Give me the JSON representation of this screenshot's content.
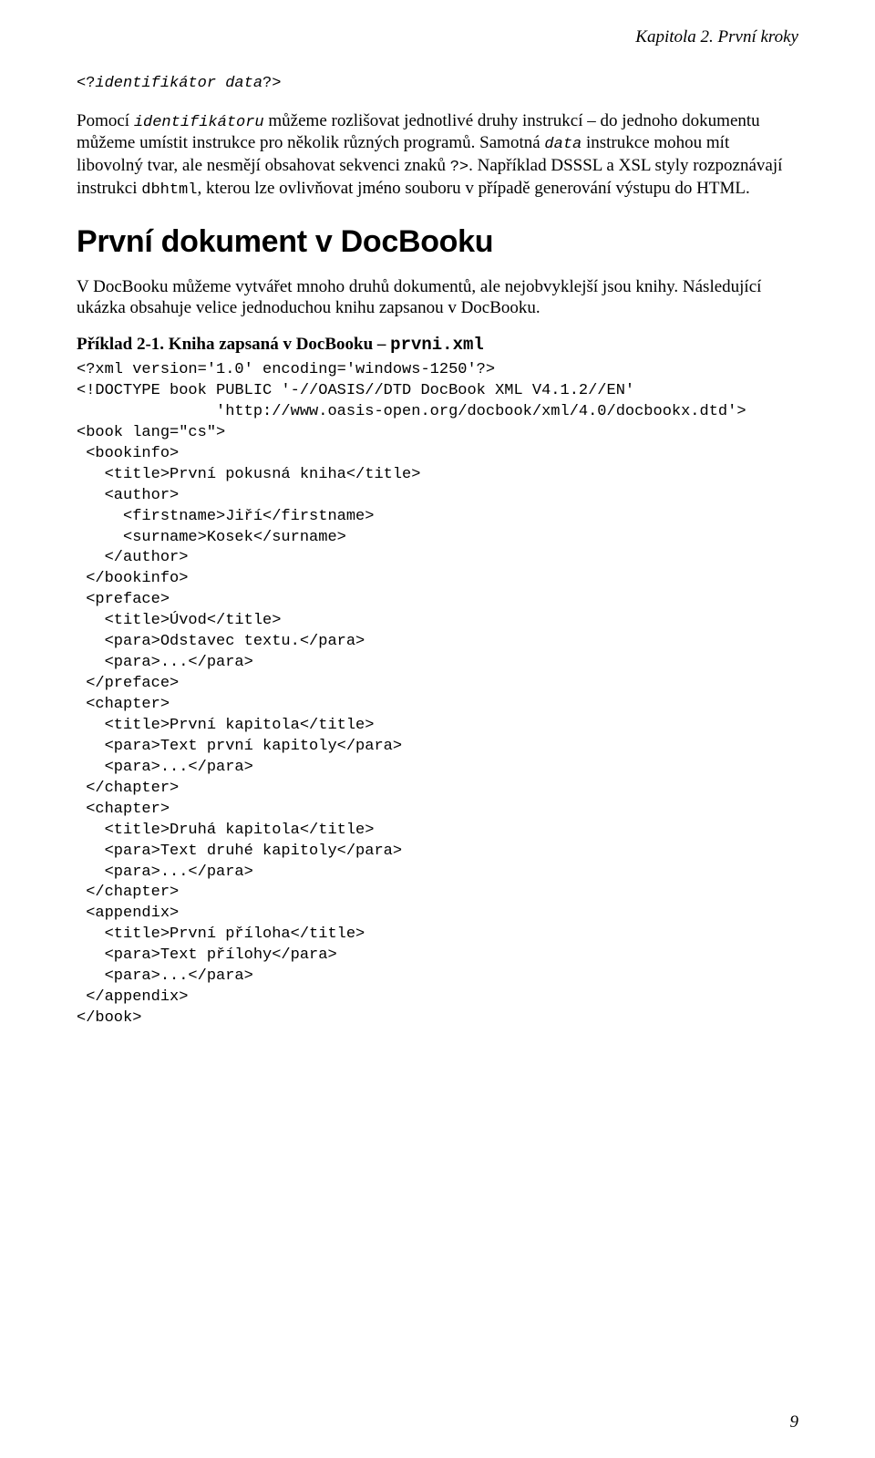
{
  "header": {
    "chapter_label": "Kapitola 2. První kroky"
  },
  "intro": {
    "line1_pre": "<?",
    "line1_ident": "identifikátor data",
    "line1_post": "?>",
    "para1_a": "Pomocí ",
    "para1_b": "identifikátoru",
    "para1_c": " můžeme rozlišovat jednotlivé druhy instrukcí – do jednoho dokumentu můžeme umístit instrukce pro několik různých programů. Samotná ",
    "para1_d": "data",
    "para1_e": " instrukce mohou mít libovolný tvar, ale nesmějí obsahovat sekvenci znaků ",
    "para1_f": "?>",
    "para1_g": ". Například DSSSL a XSL styly rozpoznávají instrukci ",
    "para1_h": "dbhtml",
    "para1_i": ", kterou lze ovlivňovat jméno souboru v případě generování výstupu do HTML."
  },
  "section": {
    "title": "První dokument v DocBooku",
    "para": "V DocBooku můžeme vytvářet mnoho druhů dokumentů, ale nejobvyklejší jsou knihy. Následující ukázka obsahuje velice jednoduchou knihu zapsanou v DocBooku."
  },
  "example": {
    "title_pre": "Příklad 2-1. Kniha zapsaná v DocBooku – ",
    "title_code": "prvni.xml",
    "code": "<?xml version='1.0' encoding='windows-1250'?>\n<!DOCTYPE book PUBLIC '-//OASIS//DTD DocBook XML V4.1.2//EN'\n               'http://www.oasis-open.org/docbook/xml/4.0/docbookx.dtd'>\n<book lang=\"cs\">\n <bookinfo>\n   <title>První pokusná kniha</title>\n   <author>\n     <firstname>Jiří</firstname>\n     <surname>Kosek</surname>\n   </author>\n </bookinfo>\n <preface>\n   <title>Úvod</title>\n   <para>Odstavec textu.</para>\n   <para>...</para>\n </preface>\n <chapter>\n   <title>První kapitola</title>\n   <para>Text první kapitoly</para>\n   <para>...</para>\n </chapter>\n <chapter>\n   <title>Druhá kapitola</title>\n   <para>Text druhé kapitoly</para>\n   <para>...</para>\n </chapter>\n <appendix>\n   <title>První příloha</title>\n   <para>Text přílohy</para>\n   <para>...</para>\n </appendix>\n</book>"
  },
  "footer": {
    "page_number": "9"
  }
}
